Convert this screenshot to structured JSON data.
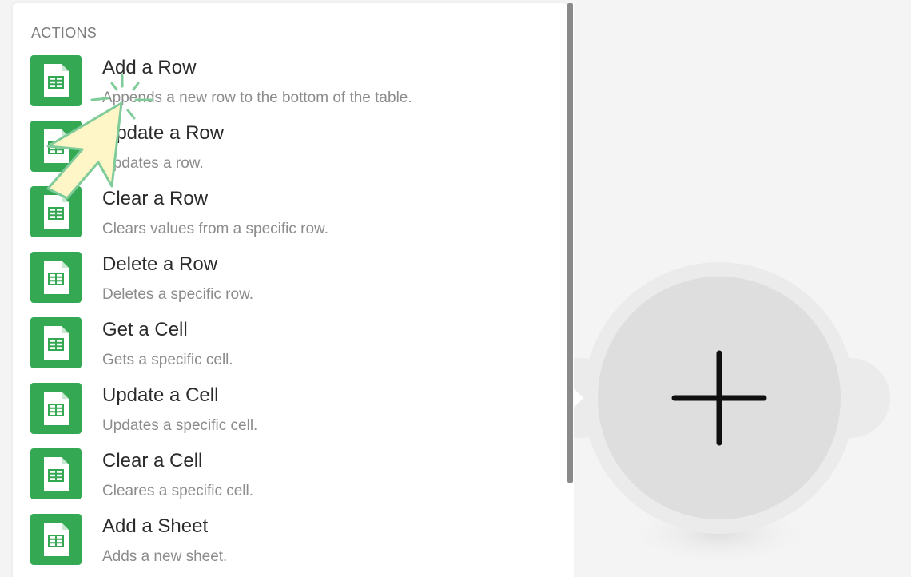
{
  "section": {
    "title": "ACTIONS"
  },
  "actions": [
    {
      "title": "Add a Row",
      "description": "Appends a new row to the bottom of the table."
    },
    {
      "title": "Update a Row",
      "description": "Updates a row."
    },
    {
      "title": "Clear a Row",
      "description": "Clears values from a specific row."
    },
    {
      "title": "Delete a Row",
      "description": "Deletes a specific row."
    },
    {
      "title": "Get a Cell",
      "description": "Gets a specific cell."
    },
    {
      "title": "Update a Cell",
      "description": "Updates a specific cell."
    },
    {
      "title": "Clear a Cell",
      "description": "Cleares a specific cell."
    },
    {
      "title": "Add a Sheet",
      "description": "Adds a new sheet."
    }
  ],
  "icons": {
    "action_icon": "sheets-icon",
    "add_module_icon": "plus-icon",
    "pointer_icon": "hand-pointer-icon"
  },
  "colors": {
    "sheets_green": "#34a853",
    "pointer_fill": "#fff6c8",
    "pointer_stroke": "#7fcc9a"
  }
}
